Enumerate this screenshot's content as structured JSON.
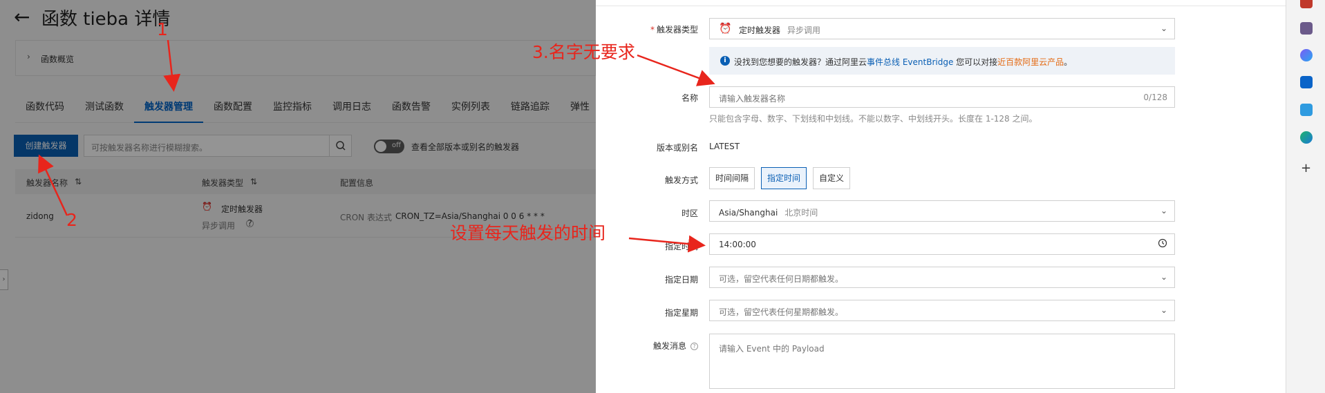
{
  "page": {
    "back_icon": "arrow-left-icon",
    "title": "函数 tieba 详情",
    "overview_label": "函数概览",
    "tabs": [
      "函数代码",
      "测试函数",
      "触发器管理",
      "函数配置",
      "监控指标",
      "调用日志",
      "函数告警",
      "实例列表",
      "链路追踪",
      "弹性"
    ],
    "active_tab": "触发器管理",
    "create_button": "创建触发器",
    "search_placeholder": "可按触发器名称进行模糊搜索。",
    "toggle_text": "off",
    "toggle_label": "查看全部版本或别名的触发器",
    "table": {
      "headers": [
        "触发器名称",
        "触发器类型",
        "配置信息"
      ],
      "rows": [
        {
          "name": "zidong",
          "type": "定时触发器",
          "call": "异步调用",
          "config_label": "CRON 表达式",
          "config_value": "CRON_TZ=Asia/Shanghai 0 0 6 * * *"
        }
      ]
    }
  },
  "drawer": {
    "trigger_type_label": "触发器类型",
    "trigger_type_value": "定时触发器",
    "trigger_type_sub": "异步调用",
    "info_prefix": "没找到您想要的触发器？通过阿里云",
    "info_link": "事件总线 EventBridge",
    "info_middle": " 您可以对接",
    "info_link2": "近百款阿里云产品",
    "info_suffix": "。",
    "name_label": "名称",
    "name_placeholder": "请输入触发器名称",
    "name_counter": "0/128",
    "name_hint": "只能包含字母、数字、下划线和中划线。不能以数字、中划线开头。长度在 1-128 之间。",
    "version_label": "版本或别名",
    "version_value": "LATEST",
    "mode_label": "触发方式",
    "mode_options": [
      "时间间隔",
      "指定时间",
      "自定义"
    ],
    "mode_selected": "指定时间",
    "timezone_label": "时区",
    "timezone_value": "Asia/Shanghai",
    "timezone_sub": "北京时间",
    "time_label": "指定时间",
    "time_value": "14:00:00",
    "date_label": "指定日期",
    "date_placeholder": "可选，留空代表任何日期都触发。",
    "week_label": "指定星期",
    "week_placeholder": "可选，留空代表任何星期都触发。",
    "payload_label": "触发消息",
    "payload_placeholder": "请输入 Event 中的 Payload"
  },
  "annotations": {
    "label_1": "1",
    "label_2": "2",
    "label_3": "3.名字无要求",
    "label_time": "设置每天触发的时间"
  },
  "colors": {
    "primary": "#0a5fb4",
    "annotation": "#e8251c",
    "overlay": "rgba(0,0,0,0.42)",
    "link_orange": "#e46a13"
  }
}
